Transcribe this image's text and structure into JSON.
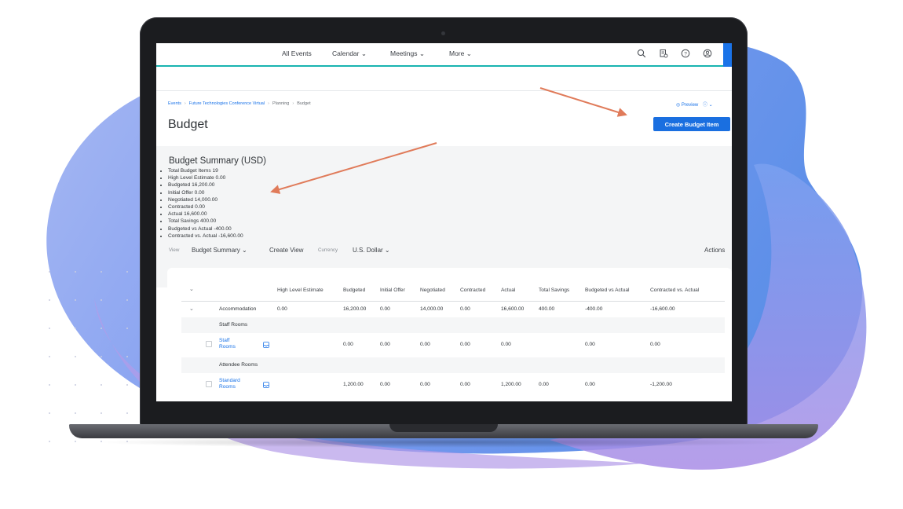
{
  "nav": {
    "items": [
      "All Events",
      "Calendar",
      "Meetings",
      "More"
    ]
  },
  "breadcrumb": {
    "items": [
      "Events",
      "Future Technologies Conference Virtual",
      "Planning",
      "Budget"
    ]
  },
  "preview_label": "Preview",
  "page_title": "Budget",
  "create_button_label": "Create Budget Item",
  "summary": {
    "title": "Budget Summary (USD)",
    "items": [
      "Total Budget Items 19",
      "High Level Estimate 0.00",
      "Budgeted 16,200.00",
      "Initial Offer 0.00",
      "Negotiated 14,000.00",
      "Contracted 0.00",
      "Actual 16,600.00",
      "Total Savings 400.00",
      "Budgeted vs Actual -400.00",
      "Contracted vs. Actual -16,600.00"
    ]
  },
  "viewbar": {
    "view_label": "View",
    "view_value": "Budget Summary",
    "create_view": "Create View",
    "currency_label": "Currency",
    "currency_value": "U.S. Dollar",
    "actions": "Actions"
  },
  "table": {
    "columns": [
      "High Level Estimate",
      "Budgeted",
      "Initial Offer",
      "Negotiated",
      "Contracted",
      "Actual",
      "Total Savings",
      "Budgeted vs Actual",
      "Contracted vs. Actual"
    ],
    "accommodation": {
      "label": "Accommodation",
      "values": [
        "0.00",
        "16,200.00",
        "0.00",
        "14,000.00",
        "0.00",
        "16,600.00",
        "400.00",
        "-400.00",
        "-16,600.00"
      ]
    },
    "group_staff": "Staff Rooms",
    "staff_item": {
      "label": "Staff Rooms",
      "values": [
        "0.00",
        "0.00",
        "0.00",
        "0.00",
        "0.00",
        "0.00",
        "0.00"
      ]
    },
    "group_attendee": "Attendee Rooms",
    "standard_item": {
      "label": "Standard Rooms",
      "values": [
        "1,200.00",
        "0.00",
        "0.00",
        "0.00",
        "1,200.00",
        "0.00",
        "0.00",
        "-1,200.00"
      ]
    }
  },
  "colors": {
    "accent": "#1a6fe0",
    "nav_underline": "#19b4b0",
    "arrow": "#e07b5a"
  }
}
